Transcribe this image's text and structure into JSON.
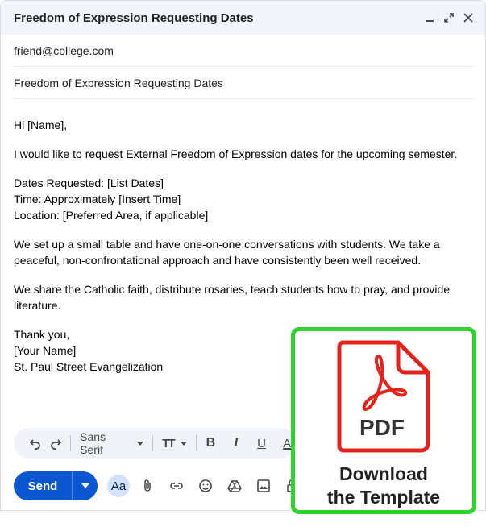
{
  "window": {
    "title": "Freedom of Expression Requesting Dates",
    "controls": [
      "minimize-icon",
      "expand-icon",
      "close-icon"
    ]
  },
  "recipients": {
    "to": "friend@college.com"
  },
  "subject": "Freedom of Expression Requesting Dates",
  "body": {
    "greeting": "Hi [Name],",
    "para1": "I would like to request External Freedom of Expression dates for the upcoming semester.",
    "details": [
      "Dates Requested: [List Dates]",
      "Time: Approximately [Insert Time]",
      "Location: [Preferred Area, if applicable]"
    ],
    "para2": "We set up a small table and have one-on-one conversations with students. We take a peaceful, non-confrontational approach and have consistently been well received.",
    "para3": "We share the Catholic faith, distribute rosaries, teach students how to pray, and provide literature.",
    "closing": [
      "Thank you,",
      "[Your Name]",
      "St. Paul Street Evangelization"
    ]
  },
  "formatting": {
    "font": "Sans Serif",
    "icons": [
      "undo-icon",
      "redo-icon",
      "text-size-icon",
      "bold-icon",
      "italic-icon",
      "underline-icon",
      "text-color-icon"
    ],
    "bold_label": "B",
    "italic_label": "I",
    "underline_label": "U",
    "color_label": "A",
    "size_label": "TT"
  },
  "actions": {
    "send_label": "Send",
    "format_toggle_label": "Aa",
    "icons": [
      "attach-icon",
      "link-icon",
      "emoji-icon",
      "drive-icon",
      "photo-icon",
      "confidential-icon"
    ]
  },
  "cta": {
    "pdf_label": "PDF",
    "line1": "Download",
    "line2": "the Template",
    "accent": "#2fd32f",
    "pdf_red": "#e0241b"
  }
}
